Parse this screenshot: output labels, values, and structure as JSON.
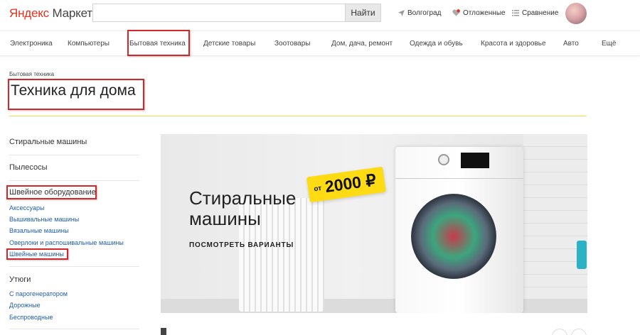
{
  "header": {
    "logo_ya": "Яндекс",
    "logo_rest": " Маркет",
    "search": {
      "placeholder": "",
      "button_label": "Найти"
    },
    "links": {
      "region": "Волгоград",
      "deferred": "Отложенные",
      "compare": "Сравнение"
    },
    "icons": [
      "location-arrow-icon",
      "heart-icon",
      "compare-list-icon"
    ],
    "colors": {
      "brand_red": "#e8301c",
      "annotation_red": "#d0282b",
      "accent_yellow": "#ffdb14"
    }
  },
  "nav": {
    "items": [
      "Электроника",
      "Компьютеры",
      "Бытовая техника",
      "Детские товары",
      "Зоотовары",
      "Дом, дача, ремонт",
      "Одежда и обувь",
      "Красота и здоровье",
      "Авто",
      "Ещё"
    ]
  },
  "page": {
    "breadcrumb": "Бытовая техника",
    "title": "Техника для дома"
  },
  "sidebar": {
    "groups": [
      {
        "title": "Стиральные машины",
        "items": []
      },
      {
        "title": "Пылесосы",
        "items": []
      },
      {
        "title": "Швейное оборудование",
        "items": [
          "Аксессуары",
          "Вышивальные машины",
          "Вязальные машины",
          "Оверлоки и распошивальные машины",
          "Швейные машины"
        ]
      },
      {
        "title": "Утюги",
        "items": [
          "С парогенератором",
          "Дорожные",
          "Беспроводные"
        ]
      }
    ]
  },
  "banner": {
    "title_line1": "Стиральные",
    "title_line2": "машины",
    "cta": "ПОСМОТРЕТЬ ВАРИАНТЫ",
    "price_prefix": "от",
    "price_value": "2000 ₽"
  }
}
